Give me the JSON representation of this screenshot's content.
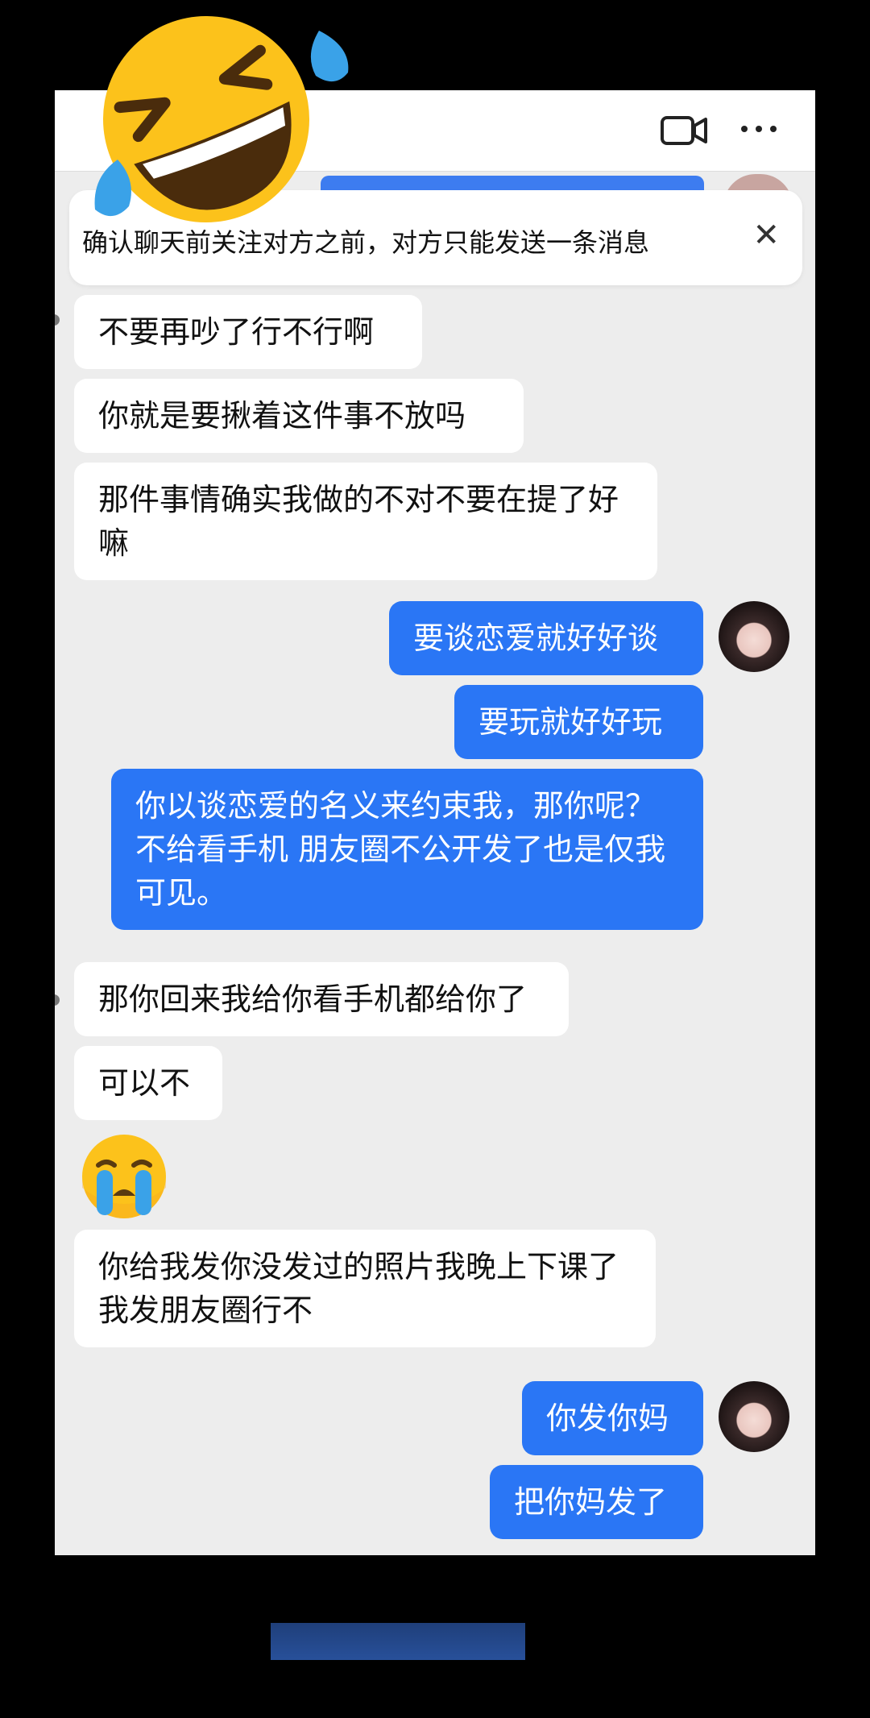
{
  "header": {
    "video_icon": "video-camera-icon",
    "more_icon": "more-dots-icon"
  },
  "banner": {
    "text": "确认聊天前关注对方之前，对方只能发送一条消息",
    "close_label": "✕"
  },
  "messages": [
    {
      "side": "received",
      "text": "不要再吵了行不行啊"
    },
    {
      "side": "received",
      "text": "你就是要揪着这件事不放吗"
    },
    {
      "side": "received",
      "text": "那件事情确实我做的不对不要在提了好嘛"
    },
    {
      "side": "sent",
      "text": "要谈恋爱就好好谈"
    },
    {
      "side": "sent",
      "text": "要玩就好好玩"
    },
    {
      "side": "sent",
      "text": "你以谈恋爱的名义来约束我，那你呢？不给看手机 朋友圈不公开发了也是仅我可见。"
    },
    {
      "side": "received",
      "text": "那你回来我给你看手机都给你了"
    },
    {
      "side": "received",
      "text": "可以不"
    },
    {
      "side": "received",
      "emoji": "crying-face-icon"
    },
    {
      "side": "received",
      "text": "你给我发你没发过的照片我晚上下课了我发朋友圈行不"
    },
    {
      "side": "sent",
      "text": "你发你妈"
    },
    {
      "side": "sent",
      "text": "把你妈发了"
    }
  ],
  "overlay": {
    "sticker": "rolling-laughing-face-icon"
  },
  "colors": {
    "sent_bubble": "#2a76f5",
    "received_bubble": "#ffffff",
    "chat_background": "#ededed"
  }
}
